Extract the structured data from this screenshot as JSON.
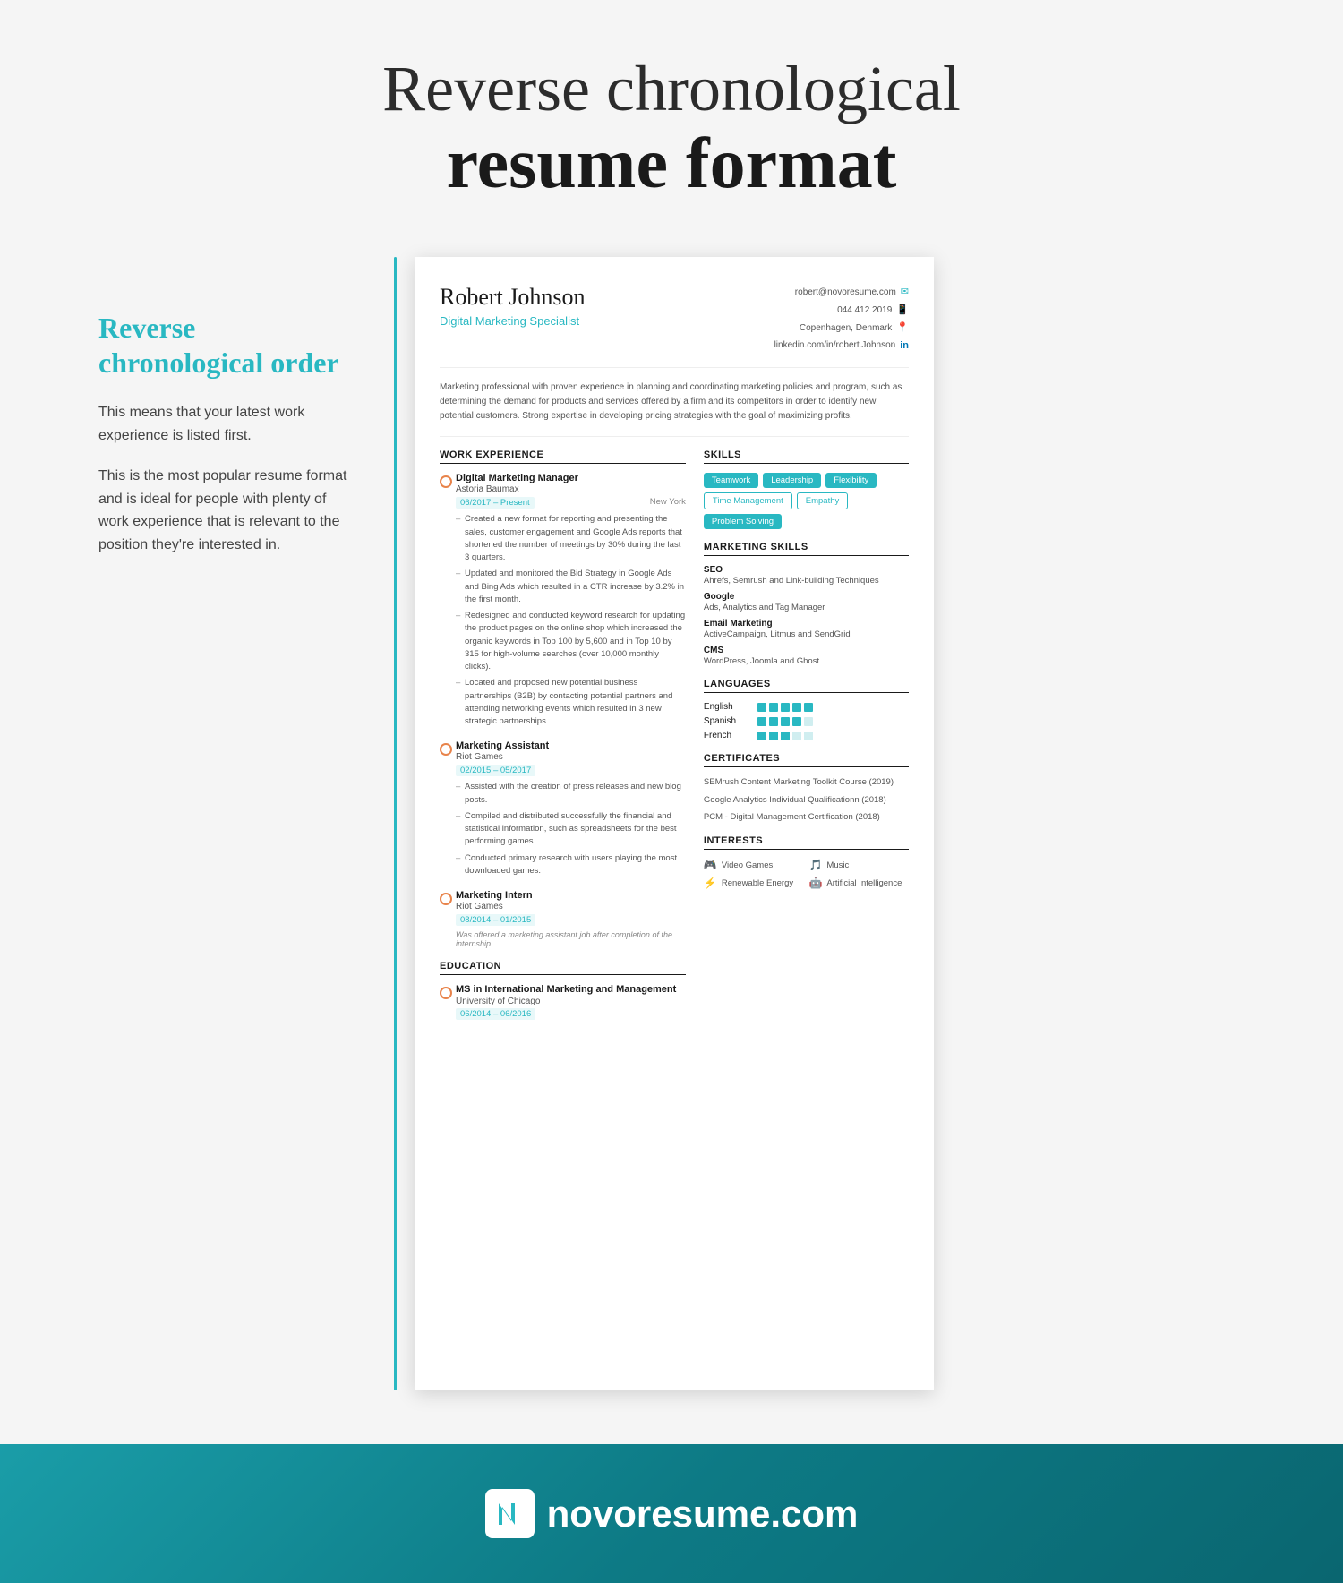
{
  "header": {
    "title_light": "Reverse chronological",
    "title_bold": "resume format"
  },
  "left_panel": {
    "section_title": "Reverse chronological order",
    "desc1": "This means that your latest work experience is listed first.",
    "desc2": "This is the most popular resume format and is ideal for people with plenty of work experience that is relevant to the position they're interested in."
  },
  "resume": {
    "name": "Robert Johnson",
    "title": "Digital Marketing Specialist",
    "contact": {
      "email": "robert@novoresume.com",
      "phone": "044 412 2019",
      "location": "Copenhagen, Denmark",
      "linkedin": "linkedin.com/in/robert.Johnson"
    },
    "summary": "Marketing professional with proven experience in planning and coordinating marketing policies and program, such as determining the demand for products and services offered by a firm and its competitors in order to identify new potential customers. Strong expertise in developing pricing strategies with the goal of maximizing profits.",
    "work_experience_header": "WORK EXPERIENCE",
    "work_entries": [
      {
        "title": "Digital Marketing Manager",
        "company": "Astoria Baumax",
        "date_range": "06/2017 – Present",
        "location": "New York",
        "bullets": [
          "Created a new format for reporting and presenting the sales, customer engagement and Google Ads reports that shortened the number of meetings by 30% during the last 3 quarters.",
          "Updated and monitored the Bid Strategy in Google Ads and Bing Ads which resulted in a CTR increase by 3.2% in the first month.",
          "Redesigned and conducted keyword research for updating the product pages on the online shop which increased the organic keywords in Top 100 by 5,600 and in Top 10 by 315 for high-volume searches (over 10,000 monthly clicks).",
          "Located and proposed new potential business partnerships (B2B) by contacting potential partners and attending networking events which resulted in 3 new strategic partnerships."
        ]
      },
      {
        "title": "Marketing Assistant",
        "company": "Riot Games",
        "date_range": "02/2015 – 05/2017",
        "location": "",
        "bullets": [
          "Assisted with the creation of press releases and new blog posts.",
          "Compiled and distributed successfully the financial and statistical information, such as spreadsheets for the best performing games.",
          "Conducted primary research with users playing the most downloaded games."
        ]
      },
      {
        "title": "Marketing Intern",
        "company": "Riot Games",
        "date_range": "08/2014 – 01/2015",
        "location": "",
        "note": "Was offered a marketing assistant job after completion of the internship.",
        "bullets": []
      }
    ],
    "education_header": "EDUCATION",
    "education": [
      {
        "degree": "MS in International Marketing and Management",
        "school": "University of Chicago",
        "dates": "06/2014 – 06/2016"
      }
    ],
    "skills_header": "SKILLS",
    "skills": [
      {
        "label": "Teamwork",
        "style": "teal"
      },
      {
        "label": "Leadership",
        "style": "teal"
      },
      {
        "label": "Flexibility",
        "style": "teal"
      },
      {
        "label": "Time Management",
        "style": "outline"
      },
      {
        "label": "Empathy",
        "style": "outline"
      },
      {
        "label": "Problem Solving",
        "style": "teal"
      }
    ],
    "marketing_skills_header": "MARKETING SKILLS",
    "marketing_skills": [
      {
        "name": "SEO",
        "detail": "Ahrefs, Semrush and Link-building Techniques"
      },
      {
        "name": "Google",
        "detail": "Ads, Analytics and Tag Manager"
      },
      {
        "name": "Email Marketing",
        "detail": "ActiveCampaign, Litmus and SendGrid"
      },
      {
        "name": "CMS",
        "detail": "WordPress, Joomla and Ghost"
      }
    ],
    "languages_header": "LANGUAGES",
    "languages": [
      {
        "name": "English",
        "filled": 5,
        "empty": 0
      },
      {
        "name": "Spanish",
        "filled": 4,
        "empty": 1
      },
      {
        "name": "French",
        "filled": 3,
        "empty": 2
      }
    ],
    "certificates_header": "CERTIFICATES",
    "certificates": [
      "SEMrush Content Marketing Toolkit Course (2019)",
      "Google Analytics Individual Qualificationn (2018)",
      "PCM - Digital Management Certification (2018)"
    ],
    "interests_header": "INTERESTS",
    "interests": [
      {
        "icon": "🎮",
        "label": "Video Games"
      },
      {
        "icon": "🎵",
        "label": "Music"
      },
      {
        "icon": "⚡",
        "label": "Renewable Energy"
      },
      {
        "icon": "🤖",
        "label": "Artificial Intelligence"
      }
    ]
  },
  "footer": {
    "domain": "novoresume.com",
    "logo_letter": "N"
  }
}
